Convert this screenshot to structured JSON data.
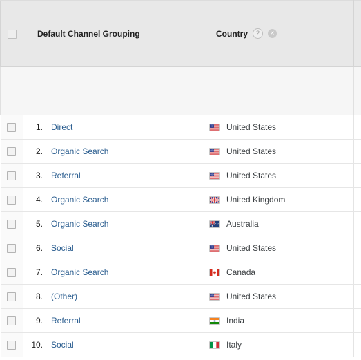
{
  "table": {
    "header": {
      "select_all_checkbox": "select-all",
      "columns": [
        {
          "label": "Default Channel Grouping",
          "has_help": false,
          "has_remove": false
        },
        {
          "label": "Country",
          "has_help": true,
          "has_remove": true,
          "help_glyph": "?",
          "remove_glyph": "×"
        }
      ]
    },
    "summary_row": {
      "cells": [
        "",
        ""
      ]
    },
    "rows": [
      {
        "rank": "1.",
        "channel": "Direct",
        "country": "United States",
        "flag": "us"
      },
      {
        "rank": "2.",
        "channel": "Organic Search",
        "country": "United States",
        "flag": "us"
      },
      {
        "rank": "3.",
        "channel": "Referral",
        "country": "United States",
        "flag": "us"
      },
      {
        "rank": "4.",
        "channel": "Organic Search",
        "country": "United Kingdom",
        "flag": "gb"
      },
      {
        "rank": "5.",
        "channel": "Organic Search",
        "country": "Australia",
        "flag": "au"
      },
      {
        "rank": "6.",
        "channel": "Social",
        "country": "United States",
        "flag": "us"
      },
      {
        "rank": "7.",
        "channel": "Organic Search",
        "country": "Canada",
        "flag": "ca"
      },
      {
        "rank": "8.",
        "channel": "(Other)",
        "country": "United States",
        "flag": "us"
      },
      {
        "rank": "9.",
        "channel": "Referral",
        "country": "India",
        "flag": "in"
      },
      {
        "rank": "10.",
        "channel": "Social",
        "country": "Italy",
        "flag": "it"
      }
    ]
  },
  "colors": {
    "link": "#2a5d8f",
    "header_bg": "#e8e8e8",
    "summary_bg": "#f6f6f6",
    "row_bg": "#ffffff",
    "checkbox_cell_bg": "#fafafa",
    "border": "#e4e4e4",
    "text": "#3c4043"
  }
}
